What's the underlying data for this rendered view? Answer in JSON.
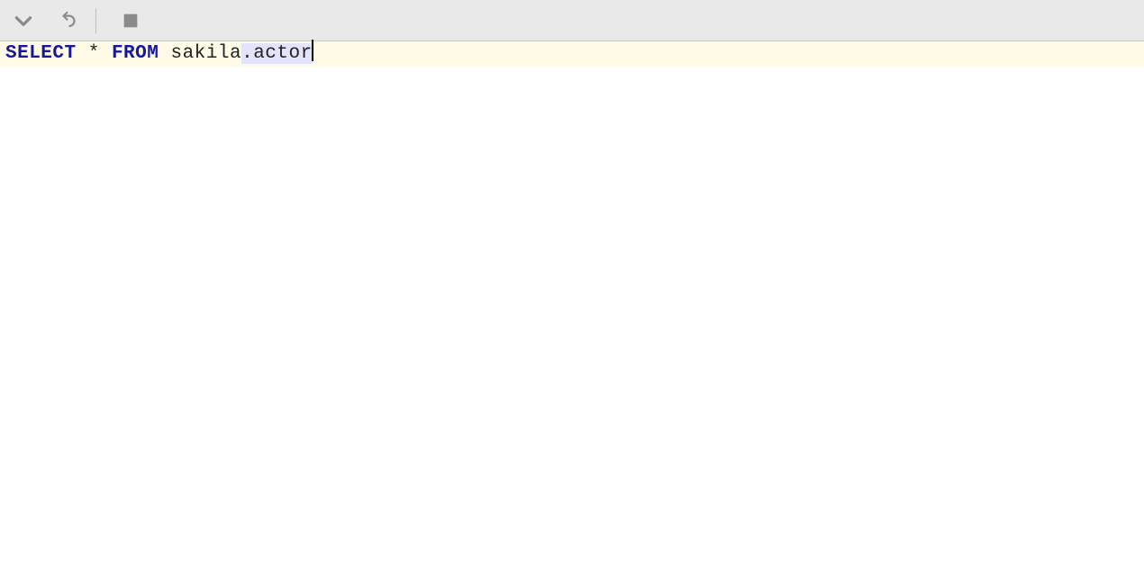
{
  "toolbar": {
    "dropdown_tooltip": "Open",
    "undo_tooltip": "Undo",
    "stop_tooltip": "Stop"
  },
  "editor": {
    "active_line_bg": "#fffbe6",
    "selection_bg": "#e3e3fb",
    "tokens": {
      "select_kw": "SELECT",
      "star": " * ",
      "from_kw": "FROM",
      "space1": " ",
      "schema": "sakila",
      "dot": ".",
      "table": "actor"
    }
  }
}
